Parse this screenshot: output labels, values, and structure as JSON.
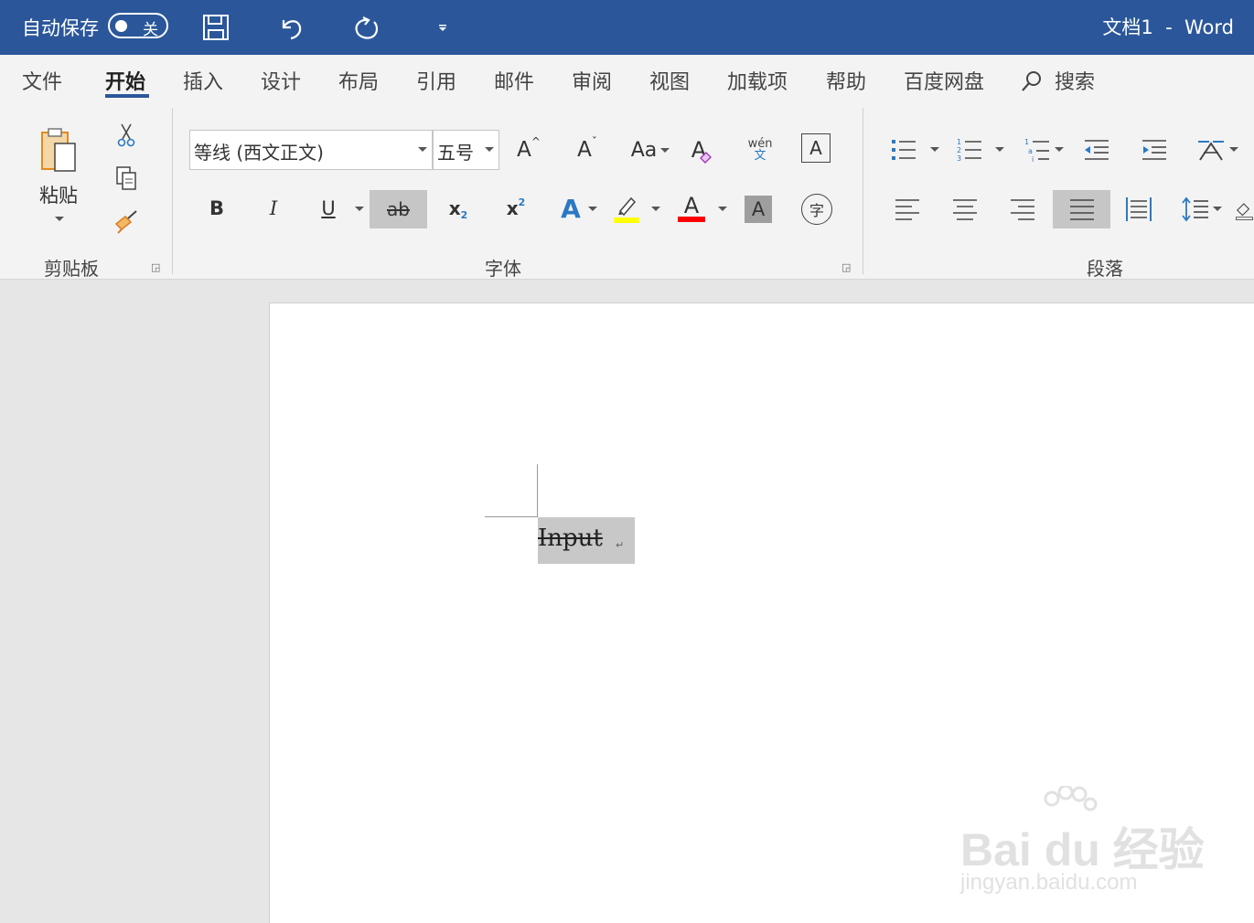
{
  "titlebar": {
    "autosave_label": "自动保存",
    "toggle_state": "关",
    "doc_title": "文档1  -  Word",
    "bg_color": "#2b579a"
  },
  "tabs": [
    "文件",
    "开始",
    "插入",
    "设计",
    "布局",
    "引用",
    "邮件",
    "审阅",
    "视图",
    "加载项",
    "帮助",
    "百度网盘"
  ],
  "active_tab": "开始",
  "search_label": "搜索",
  "clipboard": {
    "paste_label": "粘贴",
    "group_label": "剪贴板"
  },
  "font": {
    "font_name": "等线 (西文正文)",
    "font_size": "五号",
    "group_label": "字体",
    "bold": "B",
    "italic": "I",
    "underline": "U",
    "strike": "ab",
    "sub": "x",
    "sub_mark": "2",
    "sup": "x",
    "sup_mark": "2",
    "grow": "A",
    "shrink": "A",
    "case": "Aa",
    "clear": "A",
    "phonetic_top": "wén",
    "phonetic_bottom": "文",
    "border_char": "A",
    "text_effect": "A",
    "font_color_letter": "A",
    "shading_letter": "A",
    "enclose_char": "字",
    "highlight_color": "#ffff00",
    "font_color": "#ff0000"
  },
  "paragraph": {
    "group_label": "段落"
  },
  "document": {
    "text": "Input",
    "para_mark": "↵"
  },
  "watermark": {
    "big": "Bai du 经验",
    "small": "jingyan.baidu.com"
  }
}
